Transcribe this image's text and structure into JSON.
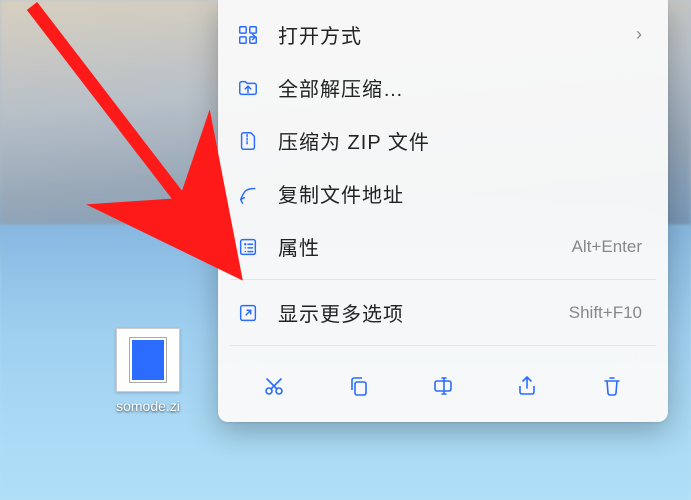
{
  "desktop": {
    "file_label": "somode.zi"
  },
  "menu": {
    "items": [
      {
        "label": "打开方式",
        "has_submenu": true,
        "icon": "open-with-icon"
      },
      {
        "label": "全部解压缩…",
        "icon": "extract-all-icon"
      },
      {
        "label": "压缩为 ZIP 文件",
        "icon": "compress-zip-icon"
      },
      {
        "label": "复制文件地址",
        "icon": "copy-path-icon"
      },
      {
        "label": "属性",
        "shortcut": "Alt+Enter",
        "icon": "properties-icon"
      },
      {
        "label": "显示更多选项",
        "shortcut": "Shift+F10",
        "icon": "show-more-icon",
        "separator_before": true
      }
    ]
  },
  "actions": {
    "cut": "cut-icon",
    "copy": "copy-icon",
    "rename": "rename-icon",
    "share": "share-icon",
    "delete": "delete-icon"
  },
  "annotation": {
    "arrow_color": "#ff1a1a"
  }
}
